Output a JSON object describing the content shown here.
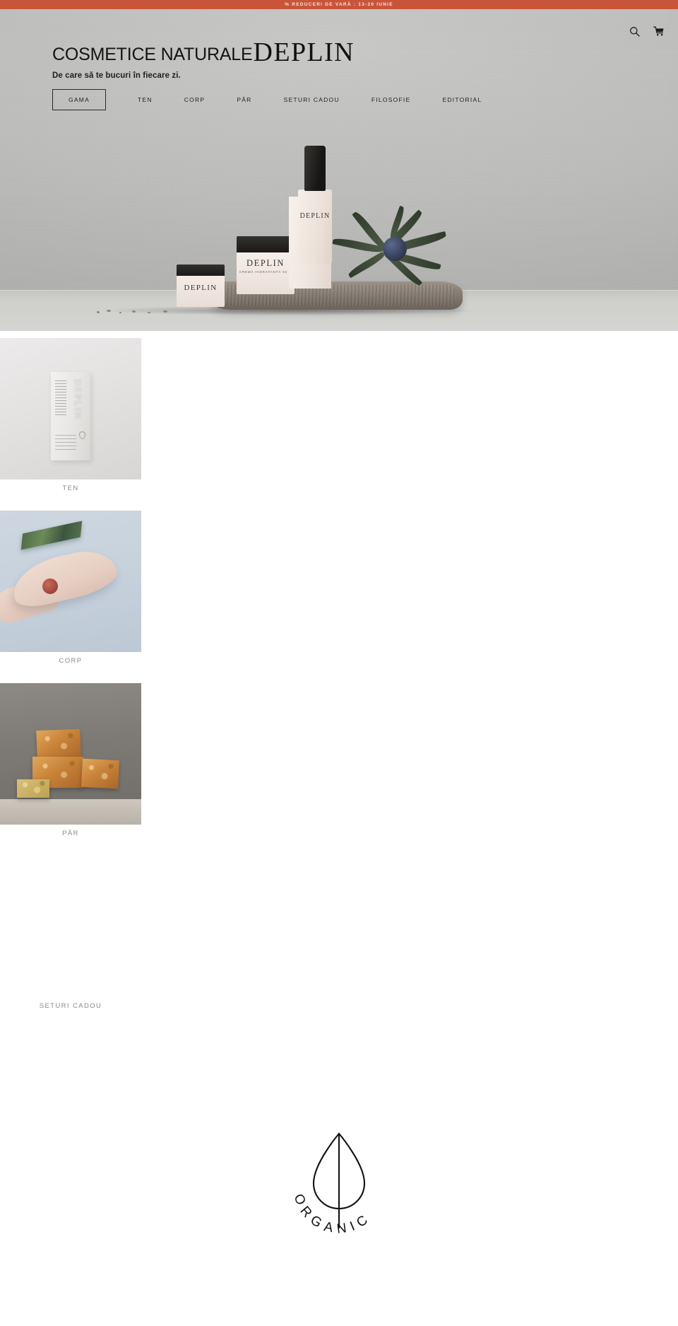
{
  "announcement": {
    "text": "% REDUCERI DE VARĂ : 13-20 IUNIE",
    "background_color": "#c8553a",
    "text_color": "#f6e4dd"
  },
  "header": {
    "logo": {
      "part_sans": "COSMETICE NATURALE",
      "part_serif": "DEPLIN"
    },
    "tagline": "De care să te bucuri în fiecare zi.",
    "icons": {
      "search": "search-icon",
      "cart": "shopping-cart-icon"
    }
  },
  "nav": {
    "items": [
      {
        "label": "GAMA",
        "active": true
      },
      {
        "label": "TEN",
        "active": false
      },
      {
        "label": "CORP",
        "active": false
      },
      {
        "label": "PĂR",
        "active": false
      },
      {
        "label": "SETURI CADOU",
        "active": false
      },
      {
        "label": "FILOSOFIE",
        "active": false
      },
      {
        "label": "EDITORIAL",
        "active": false
      }
    ]
  },
  "hero": {
    "product_labels": {
      "jar_small": "DEPLIN",
      "jar_big": "DEPLIN",
      "jar_big_sub": "CREMĂ HIDRATANTĂ 50 G",
      "dropper": "DEPLIN",
      "carton_vertical": "DEPLIN"
    }
  },
  "collections": [
    {
      "label": "TEN"
    },
    {
      "label": "CORP"
    },
    {
      "label": "PĂR"
    },
    {
      "label": "SETURI CADOU"
    }
  ],
  "footer": {
    "badge_text": "ORGANIC",
    "badge_icon": "leaf-icon"
  }
}
